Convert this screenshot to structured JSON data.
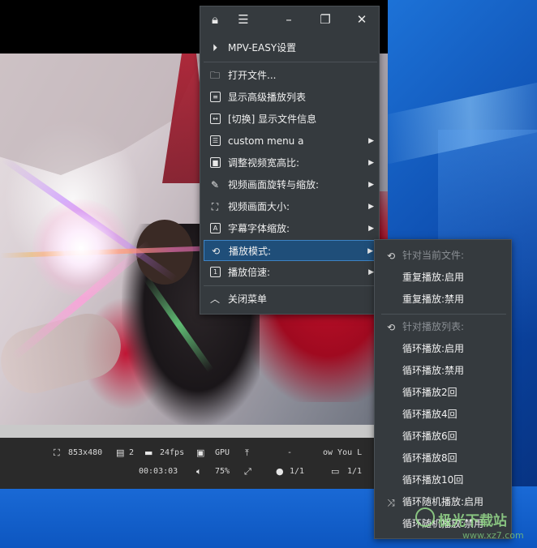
{
  "menu": {
    "titlebar": {
      "lock_icon": "lock-icon",
      "menu_icon": "hamburger-icon",
      "minimize_icon": "minimize-icon",
      "maximize_icon": "maximize-icon",
      "close_icon": "close-icon"
    },
    "header": "MPV-EASY设置",
    "items": [
      {
        "label": "打开文件...",
        "icon": "folder-icon"
      },
      {
        "label": "显示高级播放列表",
        "icon": "list-icon"
      },
      {
        "label": "[切换] 显示文件信息",
        "icon": "info-icon"
      },
      {
        "label": "custom menu a",
        "icon": "custom-menu-icon",
        "submenu": true
      },
      {
        "label": "调整视频宽高比:",
        "icon": "aspect-ratio-icon",
        "submenu": true
      },
      {
        "label": "视频画面旋转与缩放:",
        "icon": "rotate-zoom-icon",
        "submenu": true
      },
      {
        "label": "视频画面大小:",
        "icon": "screen-size-icon",
        "submenu": true
      },
      {
        "label": "字幕字体缩放:",
        "icon": "subtitle-font-icon",
        "submenu": true
      },
      {
        "label": "播放模式:",
        "icon": "loop-icon",
        "submenu": true,
        "highlighted": true
      },
      {
        "label": "播放倍速:",
        "icon": "speed-icon",
        "submenu": true
      }
    ],
    "close_label": "关闭菜单"
  },
  "submenu": {
    "section1_title": "针对当前文件:",
    "section1_items": [
      "重复播放:启用",
      "重复播放:禁用"
    ],
    "section2_title": "针对播放列表:",
    "section2_items": [
      "循环播放:启用",
      "循环播放:禁用",
      "循环播放2回",
      "循环播放4回",
      "循环播放6回",
      "循环播放8回",
      "循环播放10回"
    ],
    "shuffle_enable": "循环随机播放:启用",
    "shuffle_disable": "循环随机播放:禁用"
  },
  "player": {
    "resolution": "853x480",
    "track_count": "2",
    "fps": "24fps",
    "gpu": "GPU",
    "dash": "-",
    "title_fragment": "ow  You  L",
    "time": "00:03:03",
    "volume": "75%",
    "chapters": "1/1",
    "subtitles": "1/1"
  },
  "watermark": {
    "text": "极光下载站",
    "url": "www.xz7.com"
  },
  "colors": {
    "menu_bg": "#353a3e",
    "highlight": "#1f4e79",
    "highlight_border": "#3d83c4",
    "disabled_text": "#8a8f94"
  }
}
